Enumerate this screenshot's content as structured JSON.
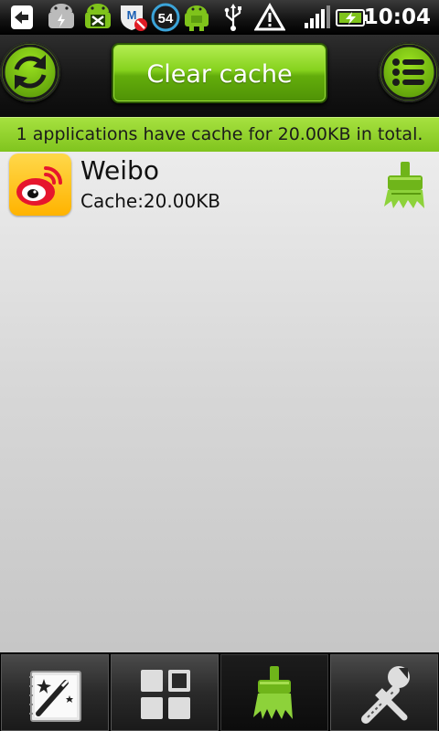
{
  "status_bar": {
    "time": "10:04",
    "notification_icons": [
      "back-arrow-icon",
      "android-charging-icon",
      "android-x-icon",
      "shield-blocked-icon",
      "speed-badge-icon",
      "android-download-icon",
      "usb-icon",
      "warning-icon"
    ],
    "badge_number": "54",
    "right_icons": [
      "signal-icon",
      "battery-charging-icon"
    ]
  },
  "toolbar": {
    "refresh_icon": "refresh-icon",
    "clear_label": "Clear cache",
    "menu_icon": "list-menu-icon"
  },
  "summary": {
    "text": "1 applications have cache for 20.00KB in total."
  },
  "apps": [
    {
      "name": "Weibo",
      "cache": "Cache:20.00KB",
      "icon": "weibo-icon",
      "action_icon": "broom-icon"
    }
  ],
  "bottom_nav": {
    "tabs": [
      {
        "icon": "magic-wand-icon",
        "active": false
      },
      {
        "icon": "grid-icon",
        "active": false
      },
      {
        "icon": "broom-icon",
        "active": true
      },
      {
        "icon": "tools-icon",
        "active": false
      }
    ]
  },
  "colors": {
    "accent_green": "#86d21d",
    "dark_green": "#4f9206",
    "toolbar_dark": "#161616"
  }
}
